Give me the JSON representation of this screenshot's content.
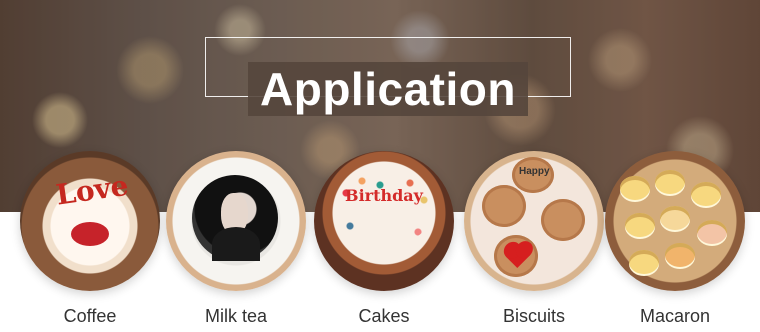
{
  "header": {
    "title": "Application"
  },
  "applications": [
    {
      "label": "Coffee",
      "print_text": "Love"
    },
    {
      "label": "Milk tea"
    },
    {
      "label": "Cakes",
      "print_text": "Birthday"
    },
    {
      "label": "Biscuits",
      "print_text": "Happy"
    },
    {
      "label": "Macaron"
    }
  ]
}
